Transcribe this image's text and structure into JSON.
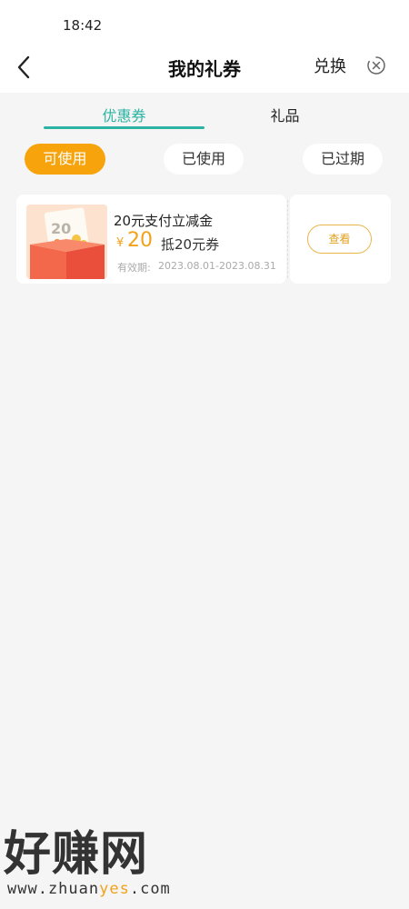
{
  "status_bar": {
    "time": "18:42"
  },
  "header": {
    "title": "我的礼券",
    "redeem_label": "兑换",
    "back_icon": "chevron-left-icon",
    "close_icon": "close-circle-icon"
  },
  "tabs": [
    {
      "label": "优惠券",
      "active": true
    },
    {
      "label": "礼品",
      "active": false
    }
  ],
  "filters": [
    {
      "label": "可使用",
      "active": true
    },
    {
      "label": "已使用",
      "active": false
    },
    {
      "label": "已过期",
      "active": false
    }
  ],
  "coupons": [
    {
      "title": "20元支付立减金",
      "currency": "¥",
      "amount": "20",
      "description": "抵20元券",
      "validity_label": "有效期:",
      "validity": "2023.08.01-2023.08.31",
      "action_label": "查看",
      "thumb_text": "20"
    }
  ],
  "watermark": {
    "brand": "好赚网",
    "url_prefix": "www.zhuan",
    "url_highlight": "yes",
    "url_suffix": ".com"
  },
  "colors": {
    "accent": "#2bb3a3",
    "pill_active": "#f7a30c",
    "amount": "#f1a21a"
  }
}
